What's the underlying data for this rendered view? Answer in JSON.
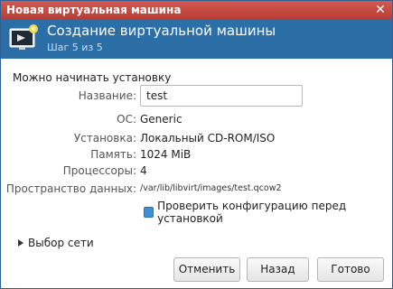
{
  "window": {
    "title": "Новая виртуальная машина",
    "close_glyph": "✕"
  },
  "header": {
    "icon": "monitor-with-star-icon",
    "title": "Создание виртуальной машины",
    "subtitle": "Шаг 5 из 5"
  },
  "main": {
    "section_title": "Можно начинать установку",
    "fields": {
      "name": {
        "label": "Название:",
        "value": "test"
      },
      "os": {
        "label": "ОС:",
        "value": "Generic"
      },
      "install": {
        "label": "Установка:",
        "value": "Локальный CD-ROM/ISO"
      },
      "memory": {
        "label": "Память:",
        "value": "1024 MiB"
      },
      "cpus": {
        "label": "Процессоры:",
        "value": "4"
      },
      "storage": {
        "label": "Пространство данных:",
        "value": "/var/lib/libvirt/images/test.qcow2"
      }
    },
    "customize": {
      "label": "Проверить конфигурацию перед установкой",
      "checked": true
    },
    "network_expander": "Выбор сети"
  },
  "buttons": {
    "cancel": "Отменить",
    "back": "Назад",
    "finish": "Готово"
  },
  "colors": {
    "titlebar": "#c0463e",
    "header": "#2c6ea6",
    "checkbox": "#3d8fd6"
  }
}
